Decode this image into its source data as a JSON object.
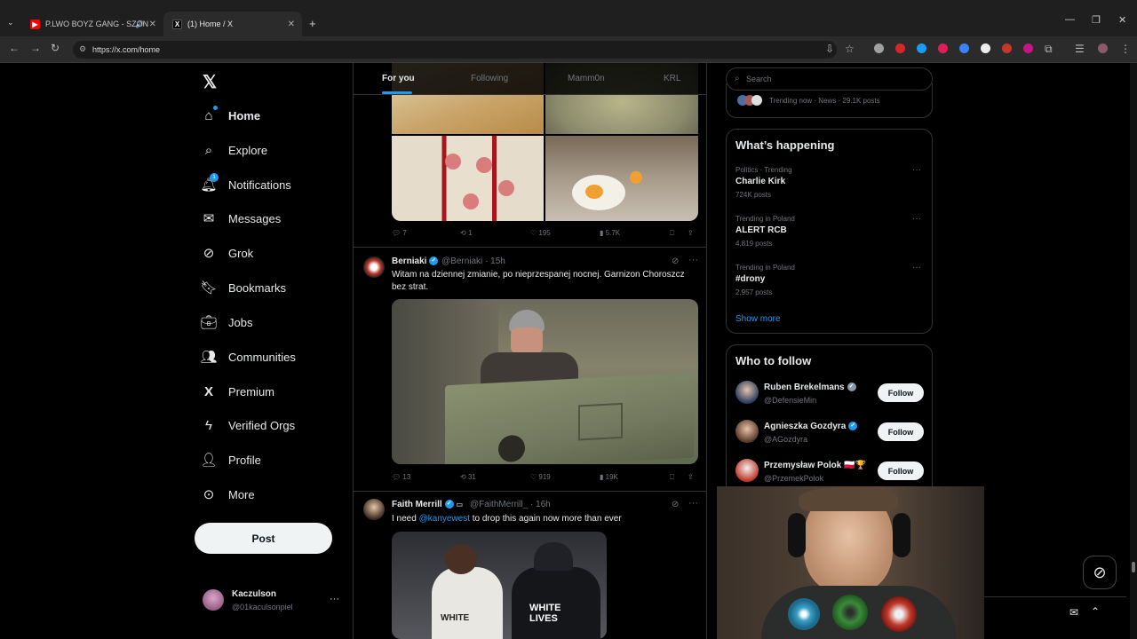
{
  "browser": {
    "tabs": [
      {
        "title": "P.LWO BOYZ GANG - SZON",
        "icon": "youtube-icon"
      },
      {
        "title": "(1) Home / X",
        "icon": "x-icon"
      }
    ],
    "url": "https://x.com/home",
    "new_tab": "+"
  },
  "sidebar": {
    "logo": "𝕏",
    "items": [
      {
        "label": "Home",
        "icon": "home-icon"
      },
      {
        "label": "Explore",
        "icon": "search-icon"
      },
      {
        "label": "Notifications",
        "icon": "bell-icon",
        "badge": "1"
      },
      {
        "label": "Messages",
        "icon": "mail-icon"
      },
      {
        "label": "Grok",
        "icon": "grok-icon"
      },
      {
        "label": "Bookmarks",
        "icon": "bookmark-icon"
      },
      {
        "label": "Jobs",
        "icon": "briefcase-icon"
      },
      {
        "label": "Communities",
        "icon": "people-icon"
      },
      {
        "label": "Premium",
        "icon": "x-icon"
      },
      {
        "label": "Verified Orgs",
        "icon": "lightning-icon"
      },
      {
        "label": "Profile",
        "icon": "person-icon"
      },
      {
        "label": "More",
        "icon": "more-circle-icon"
      }
    ],
    "post_label": "Post",
    "account": {
      "name": "Kaczulson",
      "handle": "@01kaculsonpiel",
      "more": "···"
    }
  },
  "feed": {
    "tabs": [
      "For you",
      "Following",
      "Mamm0n",
      "KRL"
    ],
    "tweets": [
      {
        "replies": "7",
        "reposts": "1",
        "likes": "195",
        "views": "5.7K"
      },
      {
        "name": "Berniaki",
        "handle": "@Berniaki",
        "time": "· 15h",
        "text": "Witam na dziennej zmianie, po nieprzespanej nocnej. Garnizon Choroszcz bez strat.",
        "replies": "13",
        "reposts": "31",
        "likes": "919",
        "views": "19K"
      },
      {
        "name": "Faith Merrill",
        "handle": "@FaithMerrill_",
        "time": "· 16h",
        "text_before": "I need ",
        "mention": "@kanyewest",
        "text_after": " to drop this again now more than ever"
      }
    ]
  },
  "right": {
    "search_placeholder": "Search",
    "trending_now": "Trending now · News · 29.1K posts",
    "whats_happening": {
      "title": "What’s happening",
      "items": [
        {
          "meta": "Politics · Trending",
          "title": "Charlie Kirk",
          "posts": "724K posts"
        },
        {
          "meta": "Trending in Poland",
          "title": "ALERT RCB",
          "posts": "4,819 posts"
        },
        {
          "meta": "Trending in Poland",
          "title": "#drony",
          "posts": "2,957 posts"
        }
      ],
      "show_more": "Show more"
    },
    "who_to_follow": {
      "title": "Who to follow",
      "items": [
        {
          "name": "Ruben Brekelmans",
          "handle": "@DefensieMin",
          "follow": "Follow"
        },
        {
          "name": "Agnieszka Gozdyra",
          "handle": "@AGozdyra",
          "follow": "Follow"
        },
        {
          "name": "Przemysław Polok 🇵🇱🏆",
          "handle": "@PrzemekPolok",
          "follow": "Follow"
        }
      ]
    }
  },
  "colors": {
    "accent": "#1d9bf0",
    "bg": "#000000",
    "border": "#2f3336",
    "muted": "#71767b"
  }
}
